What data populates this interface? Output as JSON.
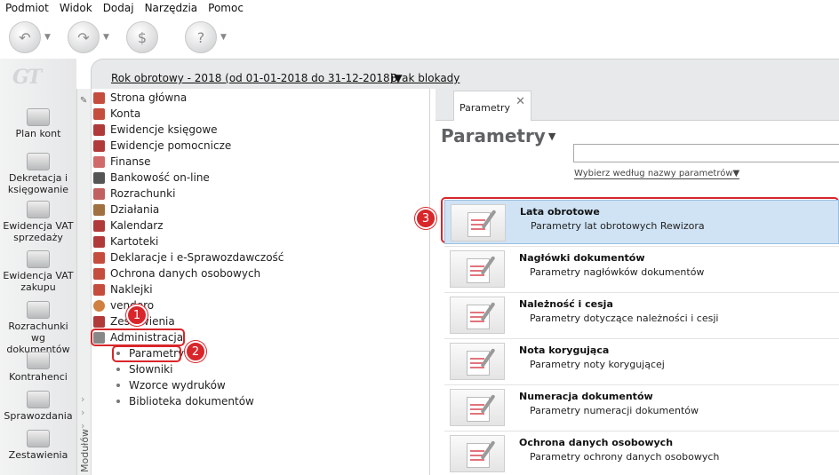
{
  "menu": [
    "Podmiot",
    "Widok",
    "Dodaj",
    "Narzędzia",
    "Pomoc"
  ],
  "toolbar": {
    "icons": [
      "back-icon",
      "forward-icon",
      "finance-icon",
      "help-icon"
    ]
  },
  "logo_text": "GT",
  "left_nav": [
    {
      "label": "Plan kont",
      "icon": "chart-of-accounts-icon"
    },
    {
      "label": "Dekretacja i księgowanie",
      "icon": "posting-icon"
    },
    {
      "label": "Ewidencja VAT sprzedaży",
      "icon": "vat-sales-icon"
    },
    {
      "label": "Ewidencja VAT zakupu",
      "icon": "vat-purchase-icon"
    },
    {
      "label": "Rozrachunki wg dokumentów",
      "icon": "settlements-icon"
    },
    {
      "label": "Kontrahenci",
      "icon": "contractors-icon"
    },
    {
      "label": "Sprawozdania",
      "icon": "reports-icon"
    },
    {
      "label": "Zestawienia",
      "icon": "statements-icon"
    }
  ],
  "header": {
    "fiscal_year": "Rok obrotowy - 2018  (od 01-01-2018 do 31-12-2018)▼",
    "lock_status": "Brak blokady"
  },
  "tree": {
    "modules_label": "Modułów",
    "items": [
      {
        "label": "Strona główna",
        "color": "#c44d3e"
      },
      {
        "label": "Konta",
        "color": "#c44d3e"
      },
      {
        "label": "Ewidencje księgowe",
        "color": "#b03a3a"
      },
      {
        "label": "Ewidencje pomocnicze",
        "color": "#b03a3a"
      },
      {
        "label": "Finanse",
        "color": "#d16a6a"
      },
      {
        "label": "Bankowość on-line",
        "color": "#555555"
      },
      {
        "label": "Rozrachunki",
        "color": "#c06060"
      },
      {
        "label": "Działania",
        "color": "#a07040"
      },
      {
        "label": "Kalendarz",
        "color": "#b03a3a"
      },
      {
        "label": "Kartoteki",
        "color": "#b03a3a"
      },
      {
        "label": "Deklaracje i e-Sprawozdawczość",
        "color": "#c44d3e"
      },
      {
        "label": "Ochrona danych osobowych",
        "color": "#c44d3e"
      },
      {
        "label": "Naklejki",
        "color": "#c44d3e"
      },
      {
        "label": "vendero",
        "color": "#d08040"
      },
      {
        "label": "Zestawienia",
        "color": "#b03a3a"
      },
      {
        "label": "Administracja",
        "color": "#888888"
      }
    ],
    "sub_items": [
      "Parametry",
      "Słowniki",
      "Wzorce wydruków",
      "Biblioteka dokumentów"
    ]
  },
  "badges": [
    "1",
    "2",
    "3"
  ],
  "tab": {
    "label": "Parametry",
    "close": "✕"
  },
  "panel": {
    "title": "Parametry",
    "filter_label": "Wybierz według nazwy parametrów▼",
    "rows": [
      {
        "title": "Lata obrotowe",
        "subtitle": "Parametry lat obrotowych Rewizora"
      },
      {
        "title": "Nagłówki dokumentów",
        "subtitle": "Parametry nagłówków dokumentów"
      },
      {
        "title": "Należność i cesja",
        "subtitle": "Parametry dotyczące należności i cesji"
      },
      {
        "title": "Nota korygująca",
        "subtitle": "Parametry noty korygującej"
      },
      {
        "title": "Numeracja dokumentów",
        "subtitle": "Parametry numeracji dokumentów"
      },
      {
        "title": "Ochrona danych osobowych",
        "subtitle": "Parametry ochrony danych osobowych"
      }
    ]
  }
}
